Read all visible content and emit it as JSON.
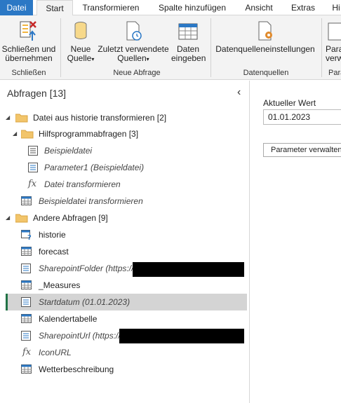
{
  "menu": {
    "tabs": [
      "Datei",
      "Start",
      "Transformieren",
      "Spalte hinzufügen",
      "Ansicht",
      "Extras",
      "Hi"
    ]
  },
  "ribbon": {
    "close_apply": "Schließen und übernehmen",
    "new_source": "Neue Quelle",
    "recent_sources": "Zuletzt verwendete Quellen",
    "enter_data": "Daten eingeben",
    "data_source_settings": "Datenquelleneinstellungen",
    "params_partial": "Para verw",
    "group_close": "Schließen",
    "group_new_query": "Neue Abfrage",
    "group_data_sources": "Datenquellen",
    "group_partial": "Para"
  },
  "queries_pane": {
    "title": "Abfragen [13]",
    "items": [
      {
        "label": "Datei aus historie transformieren [2]",
        "icon": "folder-icon"
      },
      {
        "label": "Hilfsprogrammabfragen [3]",
        "icon": "folder-icon"
      },
      {
        "label": "Beispieldatei",
        "icon": "document-icon"
      },
      {
        "label": "Parameter1 (Beispieldatei)",
        "icon": "parameter-icon"
      },
      {
        "label": "Datei transformieren",
        "icon": "function-icon"
      },
      {
        "label": "Beispieldatei transformieren",
        "icon": "table-icon"
      },
      {
        "label": "Andere Abfragen [9]",
        "icon": "folder-icon"
      },
      {
        "label": "historie",
        "icon": "table-question-icon"
      },
      {
        "label": "forecast",
        "icon": "table-icon"
      },
      {
        "label": "SharepointFolder (https://",
        "icon": "parameter-icon"
      },
      {
        "label": "_Measures",
        "icon": "table-icon"
      },
      {
        "label": "Startdatum (01.01.2023)",
        "icon": "parameter-icon"
      },
      {
        "label": "Kalendertabelle",
        "icon": "table-icon"
      },
      {
        "label": "SharepointUrl (https://",
        "icon": "parameter-icon"
      },
      {
        "label": "IconURL",
        "icon": "function-icon"
      },
      {
        "label": "Wetterbeschreibung",
        "icon": "table-icon"
      }
    ]
  },
  "param_panel": {
    "current_value_label": "Aktueller Wert",
    "current_value": "01.01.2023",
    "manage_button": "Parameter verwalten"
  },
  "colors": {
    "accent": "#2b78c5",
    "selected_bar": "#217346",
    "selected_bg": "#d4d4d4"
  }
}
